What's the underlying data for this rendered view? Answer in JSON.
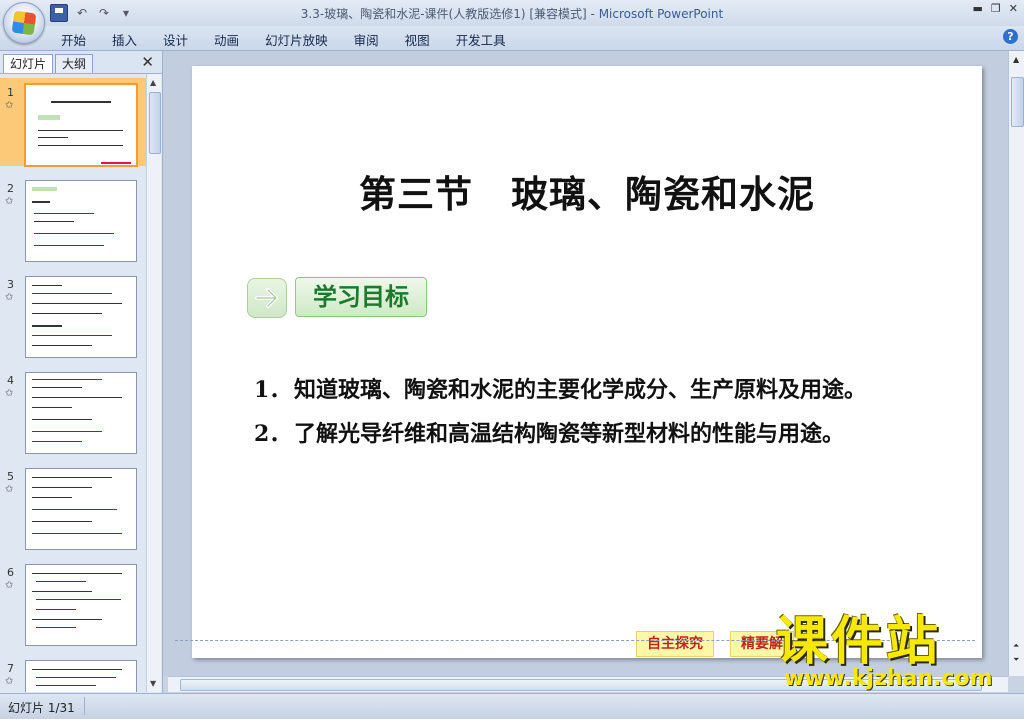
{
  "window": {
    "title": "3.3-玻璃、陶瓷和水泥-课件(人教版选修1) [兼容模式]",
    "app_name": "Microsoft PowerPoint",
    "title_sep": " - "
  },
  "ribbon_tabs": [
    "开始",
    "插入",
    "设计",
    "动画",
    "幻灯片放映",
    "审阅",
    "视图",
    "开发工具"
  ],
  "left_panel": {
    "tabs": [
      "幻灯片",
      "大纲"
    ],
    "thumbnails": [
      {
        "num": "1",
        "selected": true
      },
      {
        "num": "2",
        "selected": false
      },
      {
        "num": "3",
        "selected": false
      },
      {
        "num": "4",
        "selected": false
      },
      {
        "num": "5",
        "selected": false
      },
      {
        "num": "6",
        "selected": false
      },
      {
        "num": "7",
        "selected": false
      }
    ],
    "star": "✩"
  },
  "slide": {
    "title": "第三节　玻璃、陶瓷和水泥",
    "goal_label": "学习目标",
    "goals": [
      {
        "num": "1．",
        "text": "知道玻璃、陶瓷和水泥的主要化学成分、生产原料及用途。"
      },
      {
        "num": "2．",
        "text": "了解光导纤维和高温结构陶瓷等新型材料的性能与用途。"
      }
    ],
    "nav_buttons": [
      "自主探究",
      "精要解"
    ]
  },
  "status": {
    "slide_count": "幻灯片 1/31"
  },
  "watermark": {
    "main": "课件站",
    "url": "www.kjzhan.com"
  },
  "colors": {
    "title_bar": "#dbe5f3",
    "selected_thumb": "#fbc978",
    "goal_green": "#1d7a2c",
    "watermark_yellow": "#f7e800",
    "nav_red": "#c0261d"
  }
}
